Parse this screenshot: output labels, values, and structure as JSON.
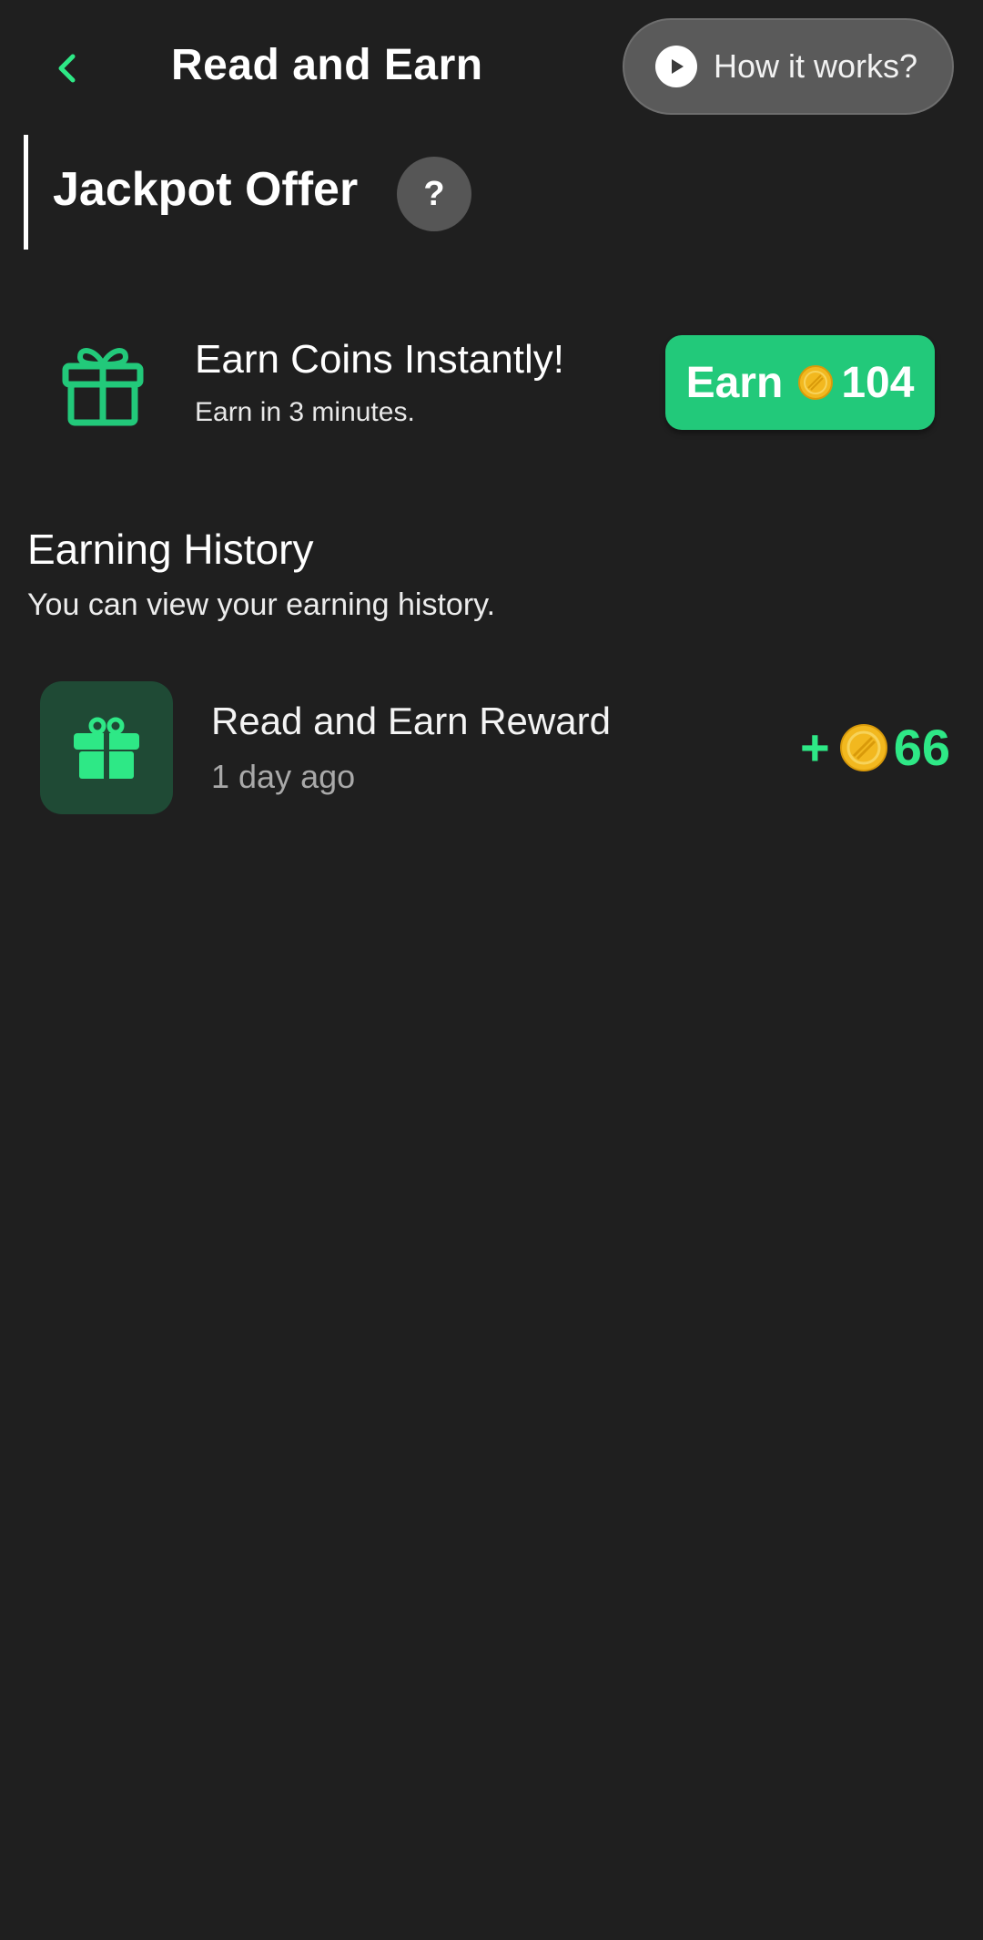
{
  "header": {
    "title": "Read and Earn",
    "how_it_works_label": "How it works?"
  },
  "jackpot": {
    "title": "Jackpot Offer",
    "help_label": "?"
  },
  "offer": {
    "title": "Earn Coins Instantly!",
    "subtitle": "Earn in 3 minutes.",
    "button_label": "Earn",
    "button_value": "104",
    "icon": "gift-icon"
  },
  "history": {
    "title": "Earning History",
    "subtitle": "You can view your earning history.",
    "items": [
      {
        "title": "Read and Earn Reward",
        "time": "1 day ago",
        "sign": "+",
        "amount": "66",
        "icon": "gift-icon"
      }
    ]
  },
  "colors": {
    "background": "#1f1f1f",
    "accent_green": "#22c97a",
    "amount_green": "#2ee886",
    "coin": "#f2b81f"
  }
}
